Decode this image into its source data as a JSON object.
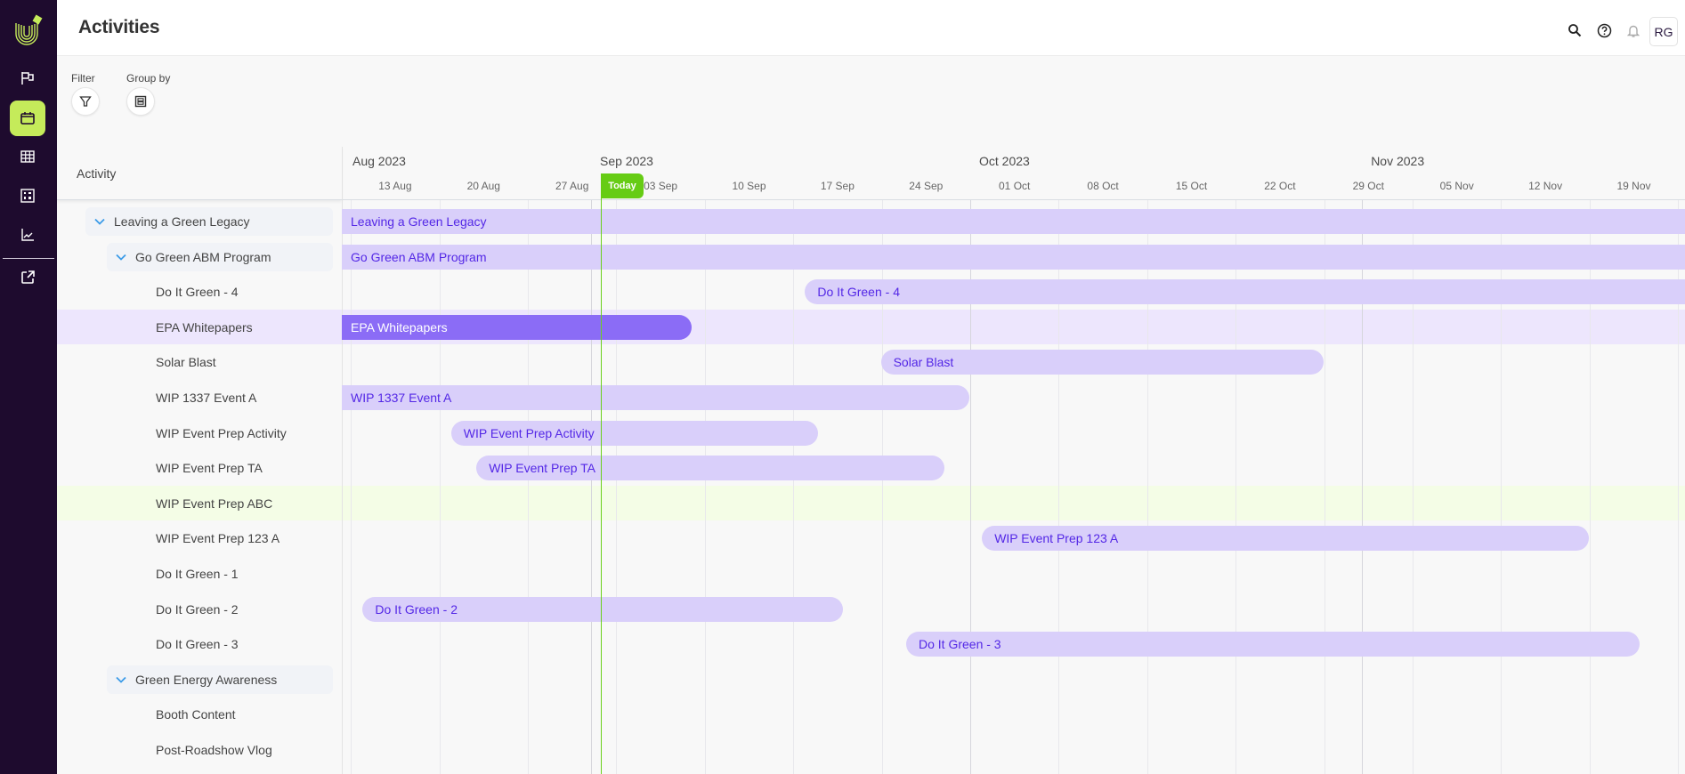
{
  "app": {
    "title": "Activities",
    "user_initials": "RG"
  },
  "rail": {
    "logo": "brand-logo",
    "items": [
      {
        "name": "campaigns",
        "icon": "flag-icon",
        "active": false
      },
      {
        "name": "calendar",
        "icon": "calendar-icon",
        "active": true
      },
      {
        "name": "table",
        "icon": "grid-table-icon",
        "active": false
      },
      {
        "name": "board",
        "icon": "dashboard-icon",
        "active": false
      },
      {
        "name": "analytics",
        "icon": "chart-line-icon",
        "active": false
      },
      {
        "name": "external",
        "icon": "external-link-icon",
        "active": false
      }
    ],
    "accent": "#c5eb5a",
    "background": "#1e0b2e"
  },
  "topbar": {
    "icons": [
      "search-icon",
      "help-icon",
      "bell-icon"
    ]
  },
  "toolbar": {
    "filter_label": "Filter",
    "group_by_label": "Group by"
  },
  "list_header": "Activity",
  "timeline": {
    "months": [
      "Aug 2023",
      "Sep 2023",
      "Oct 2023",
      "Nov 2023"
    ],
    "weeks": [
      "13 Aug",
      "20 Aug",
      "27 Aug",
      "03 Sep",
      "10 Sep",
      "17 Sep",
      "24 Sep",
      "01 Oct",
      "08 Oct",
      "15 Oct",
      "22 Oct",
      "29 Oct",
      "05 Nov",
      "12 Nov",
      "19 Nov"
    ],
    "today_label": "Today",
    "today": "2023-09-02",
    "visible_start": "2023-08-12",
    "colors": {
      "bar": "#d9cffa",
      "bar_text": "#5327e6",
      "selected_bar": "#8b6cf6",
      "today": "#66cc14"
    }
  },
  "rows": [
    {
      "label": "Leaving a Green Legacy",
      "level": 0,
      "type": "group",
      "expanded": true,
      "bar": {
        "start": "2023-08-12",
        "end": "open"
      }
    },
    {
      "label": "Go Green ABM Program",
      "level": 1,
      "type": "group",
      "expanded": true,
      "bar": {
        "start": "2023-08-12",
        "end": "open"
      }
    },
    {
      "label": "Do It Green - 4",
      "level": 2,
      "type": "activity",
      "bar": {
        "start": "2023-09-18",
        "end": "open"
      }
    },
    {
      "label": "EPA Whitepapers",
      "level": 2,
      "type": "activity",
      "selected": true,
      "bar": {
        "start": "2023-08-12",
        "end": "2023-09-09"
      }
    },
    {
      "label": "Solar Blast",
      "level": 2,
      "type": "activity",
      "bar": {
        "start": "2023-09-24",
        "end": "2023-10-29"
      }
    },
    {
      "label": "WIP 1337 Event A",
      "level": 2,
      "type": "activity",
      "bar": {
        "start": "2023-08-12",
        "end": "2023-10-01"
      }
    },
    {
      "label": "WIP Event Prep Activity",
      "level": 2,
      "type": "activity",
      "bar": {
        "start": "2023-08-21",
        "end": "2023-09-19"
      }
    },
    {
      "label": "WIP Event Prep TA",
      "level": 2,
      "type": "activity",
      "bar": {
        "start": "2023-08-23",
        "end": "2023-09-29"
      }
    },
    {
      "label": "WIP Event Prep ABC",
      "level": 2,
      "type": "activity",
      "hovered": true,
      "bar": null
    },
    {
      "label": "WIP Event Prep 123 A",
      "level": 2,
      "type": "activity",
      "bar": {
        "start": "2023-10-02",
        "end": "2023-11-19"
      }
    },
    {
      "label": "Do It Green - 1",
      "level": 2,
      "type": "activity",
      "bar": null
    },
    {
      "label": "Do It Green - 2",
      "level": 2,
      "type": "activity",
      "bar": {
        "start": "2023-08-14",
        "end": "2023-09-21"
      }
    },
    {
      "label": "Do It Green - 3",
      "level": 2,
      "type": "activity",
      "bar": {
        "start": "2023-09-26",
        "end": "2023-11-23"
      }
    },
    {
      "label": "Green Energy Awareness",
      "level": 1,
      "type": "group",
      "expanded": true,
      "bar": null
    },
    {
      "label": "Booth Content",
      "level": 2,
      "type": "activity",
      "bar": null
    },
    {
      "label": "Post-Roadshow Vlog",
      "level": 2,
      "type": "activity",
      "bar": null
    }
  ]
}
